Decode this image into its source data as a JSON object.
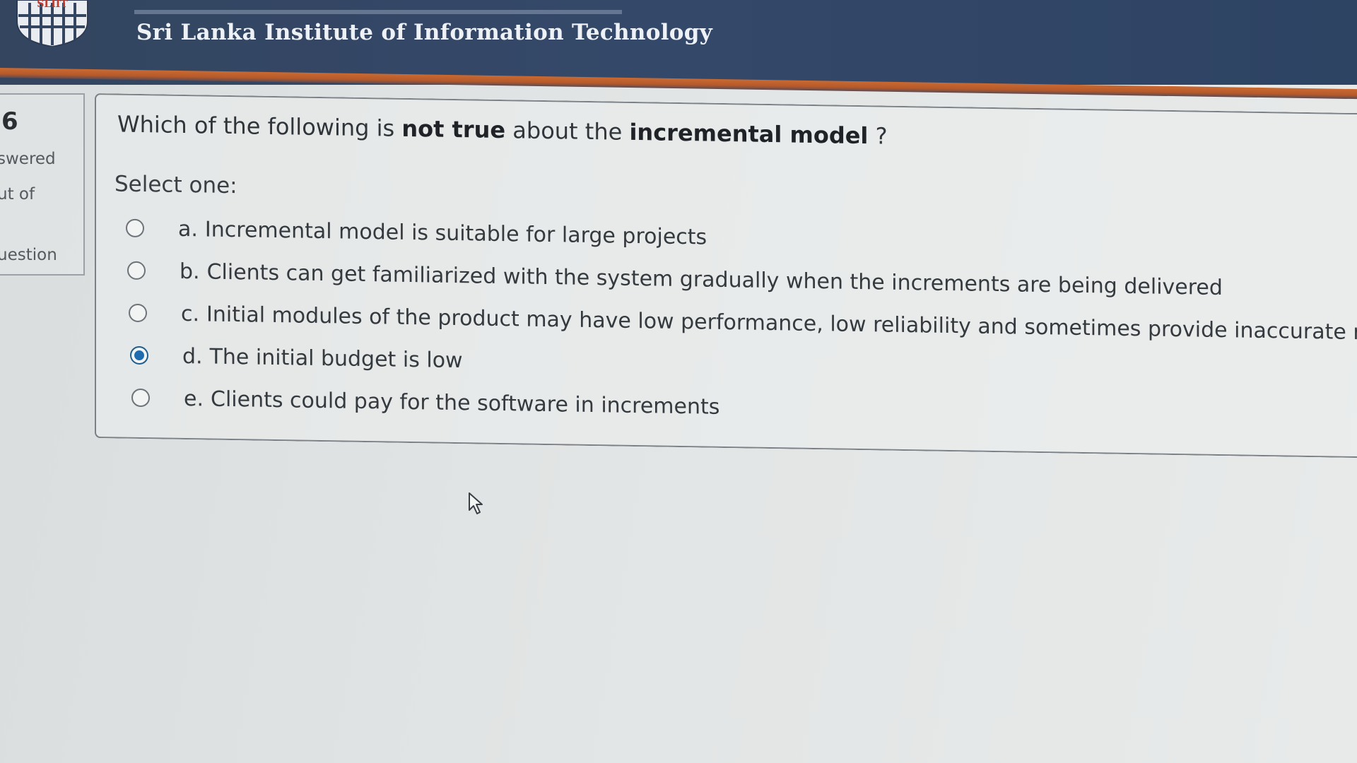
{
  "header": {
    "site_name": "Sri Lanka Institute of Information Technology",
    "logo_text": "SLIIT"
  },
  "question_info": {
    "number": "6",
    "state": "swered",
    "marks": "ut of",
    "flag": "uestion"
  },
  "question": {
    "text_before": "Which of the following is ",
    "text_bold_1": "not true",
    "text_middle": " about the ",
    "text_bold_2": "incremental model",
    "text_after": " ?",
    "prompt": "Select one:",
    "options": [
      {
        "letter": "a.",
        "text": "Incremental model is suitable for large projects",
        "selected": false
      },
      {
        "letter": "b.",
        "text": "Clients can get familiarized with the system gradually when the increments are being delivered",
        "selected": false
      },
      {
        "letter": "c.",
        "text": "Initial modules of the product may have low performance, low reliability and sometimes provide inaccurate results",
        "selected": false
      },
      {
        "letter": "d.",
        "text": "The initial budget is low",
        "selected": true
      },
      {
        "letter": "e.",
        "text": "Clients could pay for the software in increments",
        "selected": false
      }
    ]
  },
  "colors": {
    "header_bg": "#33455f",
    "header_accent": "#c96a33",
    "radio_selected": "#1f6bb0"
  }
}
